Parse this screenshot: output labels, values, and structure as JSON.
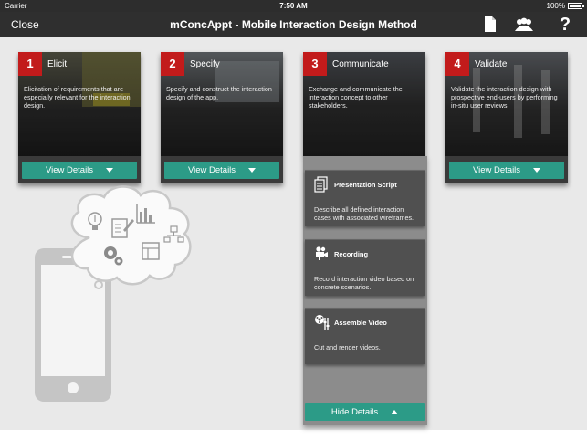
{
  "status": {
    "carrier": "Carrier",
    "time": "7:50 AM",
    "battery": "100%"
  },
  "nav": {
    "close_label": "Close",
    "title": "mConcAppt - Mobile Interaction Design Method",
    "icons": [
      "document-icon",
      "users-icon",
      "help-icon"
    ]
  },
  "cards": [
    {
      "number": "1",
      "title": "Elicit",
      "description": "Elicitation of requirements that are especially relevant for the interaction design.",
      "button": "View Details",
      "expanded": false
    },
    {
      "number": "2",
      "title": "Specify",
      "description": "Specify and construct the interaction design of the app.",
      "button": "View Details",
      "expanded": false
    },
    {
      "number": "3",
      "title": "Communicate",
      "description": "Exchange and communicate the interaction concept to other stakeholders.",
      "button": "Hide Details",
      "expanded": true
    },
    {
      "number": "4",
      "title": "Validate",
      "description": "Validate the interaction design with prospective end-users by performing in-situ user reviews.",
      "button": "View Details",
      "expanded": false
    }
  ],
  "details": [
    {
      "title": "Presentation Script",
      "description": "Describe all defined interaction cases with associated wireframes.",
      "icon": "document-stack-icon"
    },
    {
      "title": "Recording",
      "description": "Record interaction video based on concrete scenarios.",
      "icon": "video-camera-icon"
    },
    {
      "title": "Assemble Video",
      "description": "Cut and render videos.",
      "icon": "film-edit-icon"
    }
  ],
  "colors": {
    "accent": "#2c9b87",
    "number_badge": "#c21b1b",
    "navbar": "#2f2f2f",
    "background": "#e9e9e9"
  },
  "illustration": {
    "icons": [
      "lightbulb-icon",
      "edit-icon",
      "bar-chart-icon",
      "org-chart-icon",
      "gears-icon",
      "layout-icon",
      "smartphone-icon",
      "cloud-icon"
    ]
  }
}
